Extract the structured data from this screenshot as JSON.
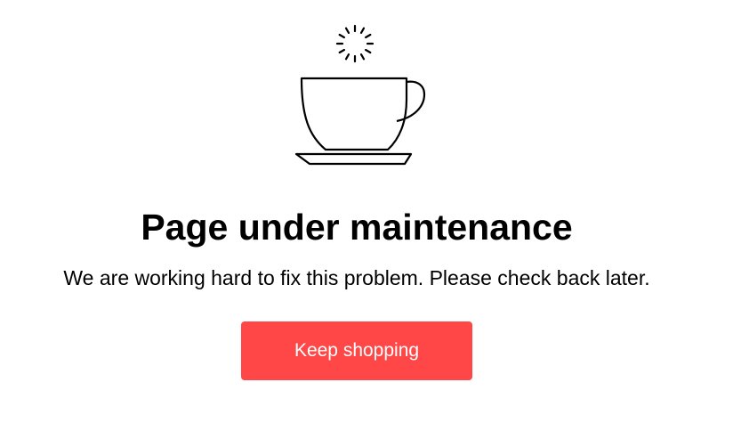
{
  "maintenance": {
    "title": "Page under maintenance",
    "message": "We are working hard to fix this problem. Please check back later.",
    "button_label": "Keep shopping",
    "illustration_icon": "coffee-cup-icon",
    "loading_icon": "loading-spinner-icon"
  },
  "colors": {
    "accent": "#ff4747",
    "text": "#000000",
    "background": "#ffffff",
    "button_text": "#ffffff"
  }
}
